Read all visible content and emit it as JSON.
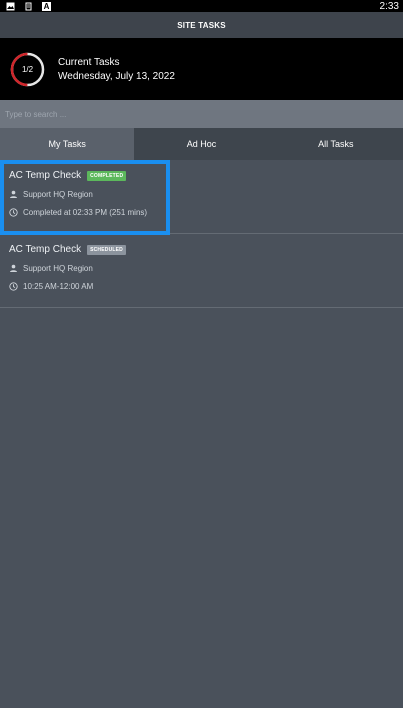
{
  "status_bar": {
    "time": "2:33",
    "icons": [
      "image-icon",
      "notification-icon",
      "app-a-icon"
    ],
    "a_glyph": "A"
  },
  "header": {
    "title": "SITE TASKS"
  },
  "summary": {
    "progress_label": "1/2",
    "progress_fraction": 0.5,
    "ring_color": "#d0262b",
    "ring_track_color": "#e6e6e6",
    "title": "Current Tasks",
    "date": "Wednesday, July 13, 2022"
  },
  "search": {
    "placeholder": "Type to search ..."
  },
  "tabs": [
    {
      "label": "My Tasks",
      "active": true
    },
    {
      "label": "Ad Hoc",
      "active": false
    },
    {
      "label": "All Tasks",
      "active": false
    }
  ],
  "tasks": [
    {
      "title": "AC Temp Check",
      "badge": "COMPLETED",
      "region": "Support HQ Region",
      "time": "Completed at 02:33 PM (251 mins)"
    },
    {
      "title": "AC Temp Check",
      "badge": "SCHEDULED",
      "region": "Support HQ Region",
      "time": "10:25 AM-12:00 AM"
    }
  ],
  "colors": {
    "highlight": "#1a8ff0",
    "completed": "#5cb85c",
    "scheduled": "#8c949e"
  }
}
